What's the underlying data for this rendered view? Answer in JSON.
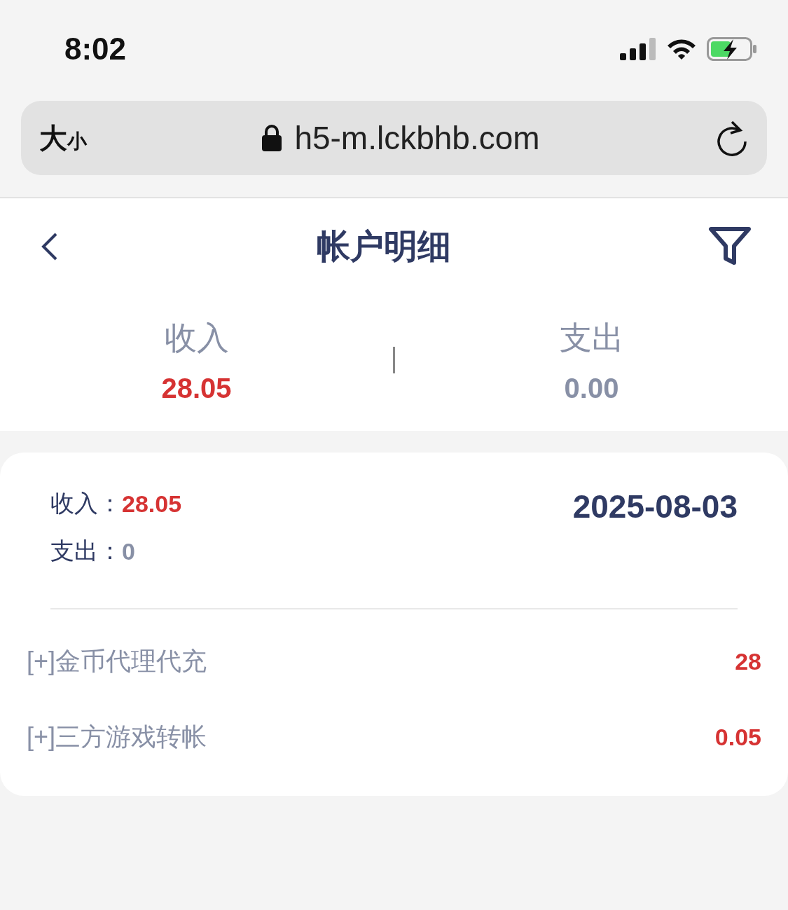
{
  "status_bar": {
    "time": "8:02"
  },
  "address_bar": {
    "text_size": "大",
    "text_size_small": "小",
    "url": "h5-m.lckbhb.com"
  },
  "header": {
    "title": "帐户明细"
  },
  "summary": [
    {
      "label": "收入",
      "value": "28.05",
      "kind": "income"
    },
    {
      "label": "支出",
      "value": "0.00",
      "kind": "expense"
    }
  ],
  "day": {
    "income_label": "收入：",
    "income": "28.05",
    "expense_label": "支出：",
    "expense": "0",
    "date": "2025-08-03",
    "entries": [
      {
        "label": "[+]金币代理代充",
        "amount": "28"
      },
      {
        "label": "[+]三方游戏转帐",
        "amount": "0.05"
      }
    ]
  }
}
